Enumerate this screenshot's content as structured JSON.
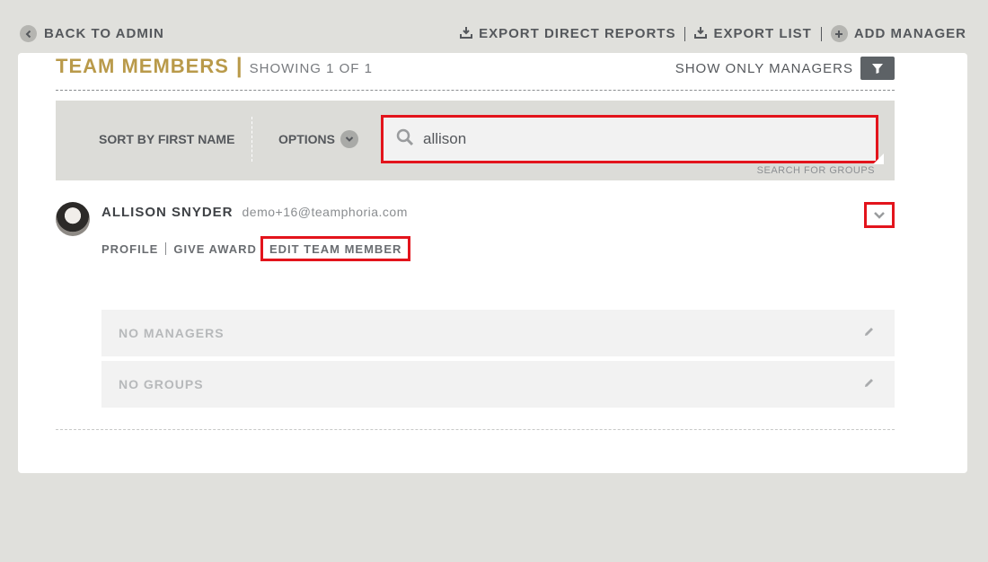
{
  "topbar": {
    "back_label": "BACK TO ADMIN",
    "actions": [
      {
        "label": "EXPORT DIRECT REPORTS",
        "icon": "download-icon"
      },
      {
        "label": "EXPORT LIST",
        "icon": "download-icon"
      },
      {
        "label": "ADD MANAGER",
        "icon": "plus-circle-icon"
      }
    ]
  },
  "header": {
    "title": "TEAM MEMBERS",
    "separator": "|",
    "showing": "SHOWING 1 OF 1",
    "show_managers_label": "SHOW ONLY MANAGERS",
    "filter_icon": "funnel-icon"
  },
  "search": {
    "sort_label": "SORT BY FIRST NAME",
    "options_label": "OPTIONS",
    "query": "allison",
    "search_groups_label": "SEARCH FOR GROUPS",
    "search_icon": "magnifier-icon"
  },
  "member": {
    "name": "ALLISON SNYDER",
    "email": "demo+16@teamphoria.com",
    "links": {
      "profile": "PROFILE",
      "give_award": "GIVE AWARD",
      "edit": "EDIT TEAM MEMBER"
    },
    "managers_label": "NO MANAGERS",
    "groups_label": "NO GROUPS"
  },
  "colors": {
    "accent_gold": "#b99a4a",
    "highlight_red": "#e3141c",
    "background": "#e0e0dc",
    "text_dark": "#55585c"
  }
}
